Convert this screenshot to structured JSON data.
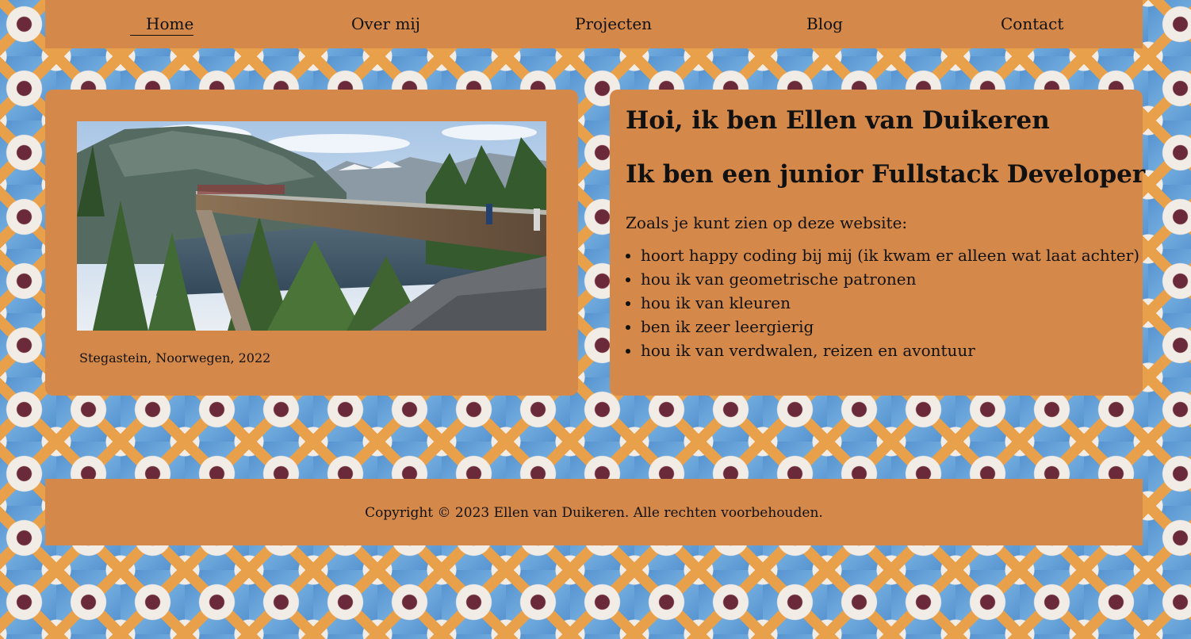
{
  "nav": {
    "items": [
      {
        "label": "Home",
        "active": true
      },
      {
        "label": "Over mij",
        "active": false
      },
      {
        "label": "Projecten",
        "active": false
      },
      {
        "label": "Blog",
        "active": false
      },
      {
        "label": "Contact",
        "active": false
      }
    ]
  },
  "photo_card": {
    "caption": "Stegastein, Noorwegen, 2022"
  },
  "intro": {
    "heading": "Hoi, ik ben Ellen van Duikeren",
    "subheading": "Ik ben een junior Fullstack Developer",
    "lead": "Zoals je kunt zien op deze website:",
    "list": [
      "hoort happy coding bij mij (ik kwam er alleen wat laat achter)",
      "hou ik van geometrische patronen",
      "hou ik van kleuren",
      "ben ik zeer leergierig",
      "hou ik van verdwalen, reizen en avontuur"
    ]
  },
  "footer": {
    "text": "Copyright © 2023 Ellen van Duikeren. Alle rechten voorbehouden."
  },
  "colors": {
    "panel": "#d4884a",
    "tile_blue": "#5b9bd5",
    "tile_accent": "#6b2a3a"
  }
}
